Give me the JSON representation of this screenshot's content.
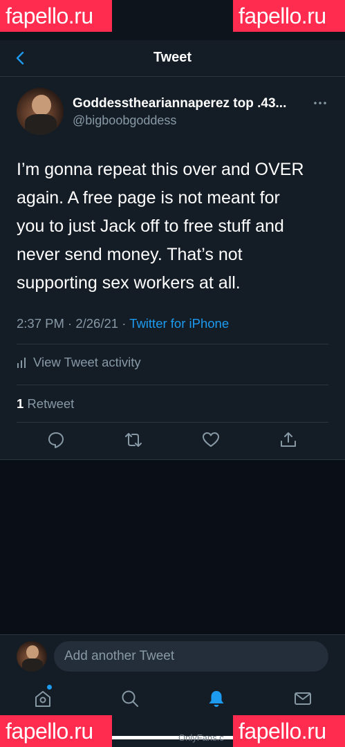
{
  "watermarks": {
    "top_left": "fapello.ru",
    "top_right": "fapello.ru",
    "bottom_left": "fapello.ru",
    "bottom_right": "fapello.ru"
  },
  "header": {
    "title": "Tweet"
  },
  "tweet": {
    "display_name": "Goddessthеariannaperez top .43...",
    "handle": "@bigboobgoddess",
    "text_lines": [
      "I’m gonna repeat this over and OVER",
      "again. A free page is not meant for",
      "you to just Jack off to free stuff and",
      "never send money. That’s not",
      "supporting sex workers at all."
    ],
    "time": "2:37 PM · 2/26/21 · ",
    "source": "Twitter for iPhone",
    "activity_label": "View Tweet activity",
    "retweet_count": "1",
    "retweet_label": " Retweet"
  },
  "reply": {
    "placeholder": "Add another Tweet"
  },
  "tabbar": {
    "tabs": [
      "home",
      "search",
      "notifications",
      "messages"
    ],
    "active": "notifications"
  },
  "bottom_caption": "OnlyFans.c",
  "colors": {
    "background": "#0e141c",
    "panel": "#141d26",
    "accent": "#1d9bf0",
    "secondary_text": "#8899a6",
    "watermark": "#ff2c4f"
  }
}
